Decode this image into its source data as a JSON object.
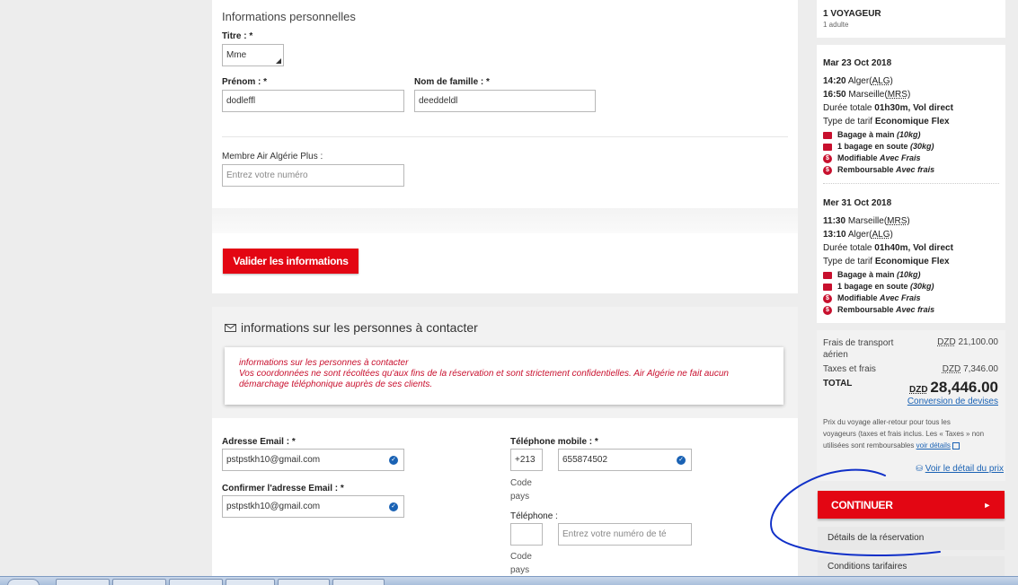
{
  "personal": {
    "heading": "Informations personnelles",
    "titre_label": "Titre : *",
    "titre_value": "Mme",
    "prenom_label": "Prénom : *",
    "prenom_value": "dodleffl",
    "nom_label": "Nom de famille : *",
    "nom_value": "deeddeldl",
    "membre_label": "Membre Air Algérie Plus :",
    "membre_placeholder": "Entrez votre numéro",
    "validate_button": "Valider les informations"
  },
  "contact": {
    "heading": "informations sur les personnes à contacter",
    "notice_title": "informations sur les personnes à contacter",
    "notice_body": "Vos coordonnées ne sont récoltées qu'aux fins de la réservation et sont strictement confidentielles. Air Algérie ne fait aucun démarchage téléphonique auprès de ses clients.",
    "email_label": "Adresse Email : *",
    "email_value": "pstpstkh10@gmail.com",
    "confirm_label": "Confirmer l'adresse Email : *",
    "confirm_value": "pstpstkh10@gmail.com",
    "mobile_label": "Téléphone mobile : *",
    "mobile_code": "+213",
    "mobile_number": "655874502",
    "code_pays_1": "Code",
    "code_pays_2": "pays",
    "phone_label": "Téléphone :",
    "phone_placeholder": "Entrez votre numéro de té"
  },
  "summary": {
    "travellers": "1 VOYAGEUR",
    "travellers_sub": "1 adulte",
    "flights": [
      {
        "date": "Mar 23 Oct 2018",
        "dep_time": "14:20",
        "dep_city": "Alger",
        "dep_code": "ALG",
        "arr_time": "16:50",
        "arr_city": "Marseille",
        "arr_code": "MRS",
        "duration_prefix": "Durée totale",
        "duration": "01h30m, Vol direct",
        "fare_prefix": "Type de tarif",
        "fare": "Economique Flex",
        "bag_hand": "Bagage à main",
        "bag_hand_w": "(10kg)",
        "bag_hold": "1 bagage en soute",
        "bag_hold_w": "(30kg)",
        "modif": "Modifiable",
        "modif_v": "Avec Frais",
        "remb": "Remboursable",
        "remb_v": "Avec frais"
      },
      {
        "date": "Mer 31 Oct 2018",
        "dep_time": "11:30",
        "dep_city": "Marseille",
        "dep_code": "MRS",
        "arr_time": "13:10",
        "arr_city": "Alger",
        "arr_code": "ALG",
        "duration_prefix": "Durée totale",
        "duration": "01h40m, Vol direct",
        "fare_prefix": "Type de tarif",
        "fare": "Economique Flex",
        "bag_hand": "Bagage à main",
        "bag_hand_w": "(10kg)",
        "bag_hold": "1 bagage en soute",
        "bag_hold_w": "(30kg)",
        "modif": "Modifiable",
        "modif_v": "Avec Frais",
        "remb": "Remboursable",
        "remb_v": "Avec frais"
      }
    ],
    "transport_label_1": "Frais de transport",
    "transport_label_2": "aérien",
    "transport_cur": "DZD",
    "transport_value": "21,100.00",
    "taxes_label": "Taxes et frais",
    "taxes_cur": "DZD",
    "taxes_value": "7,346.00",
    "total_label": "TOTAL",
    "total_cur": "DZD",
    "total_value": "28,446.00",
    "conversion_link": "Conversion de devises",
    "note_1": "Prix du voyage aller-retour pour tous les",
    "note_2": "voyageurs (taxes et frais inclus. Les « Taxes » non",
    "note_3": "utilisées sont remboursables",
    "note_link": "voir détails",
    "detail_link": "Voir le détail du prix",
    "continue_button": "CONTINUER",
    "details_resa": "Détails de la réservation",
    "conditions": "Conditions tarifaires"
  },
  "colors": {
    "accent_red": "#e30613",
    "link_blue": "#1a62b4",
    "annotation_blue": "#1030c8"
  }
}
